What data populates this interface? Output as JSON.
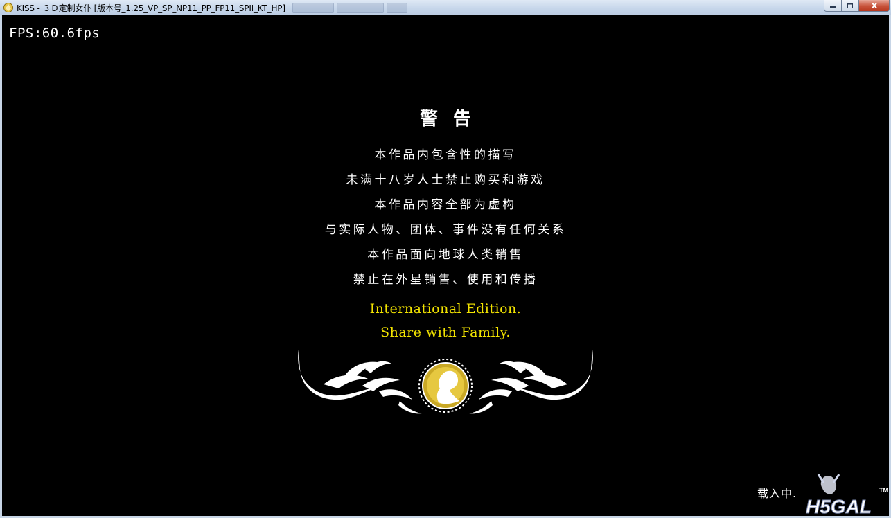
{
  "window": {
    "title": "KISS - ３Ｄ定制女仆 [版本号_1.25_VP_SP_NP11_PP_FP11_SPII_KT_HP]",
    "icon": "app-icon",
    "controls": [
      "minimize-icon",
      "maximize-icon",
      "close-icon"
    ]
  },
  "game": {
    "fps": "FPS:60.6fps",
    "warning": {
      "title": "警告",
      "lines": [
        "本作品内包含性的描写",
        "未满十八岁人士禁止购买和游戏",
        "本作品内容全部为虚构",
        "与实际人物、团体、事件没有任何关系",
        "本作品面向地球人类销售",
        "禁止在外星销售、使用和传播"
      ]
    },
    "edition": {
      "line1": "International Edition.",
      "line2": "Share with Family."
    },
    "emblem": "ornamental-emblem",
    "loading": "载入中.",
    "watermark": {
      "text": "H5GAL",
      "trademark": "TM"
    }
  },
  "colors": {
    "background": "#000000",
    "warning_text": "#ffffff",
    "edition_text": "#f2e300",
    "emblem_gold": "#c9a825",
    "titlebar": "#c6d6ea"
  }
}
